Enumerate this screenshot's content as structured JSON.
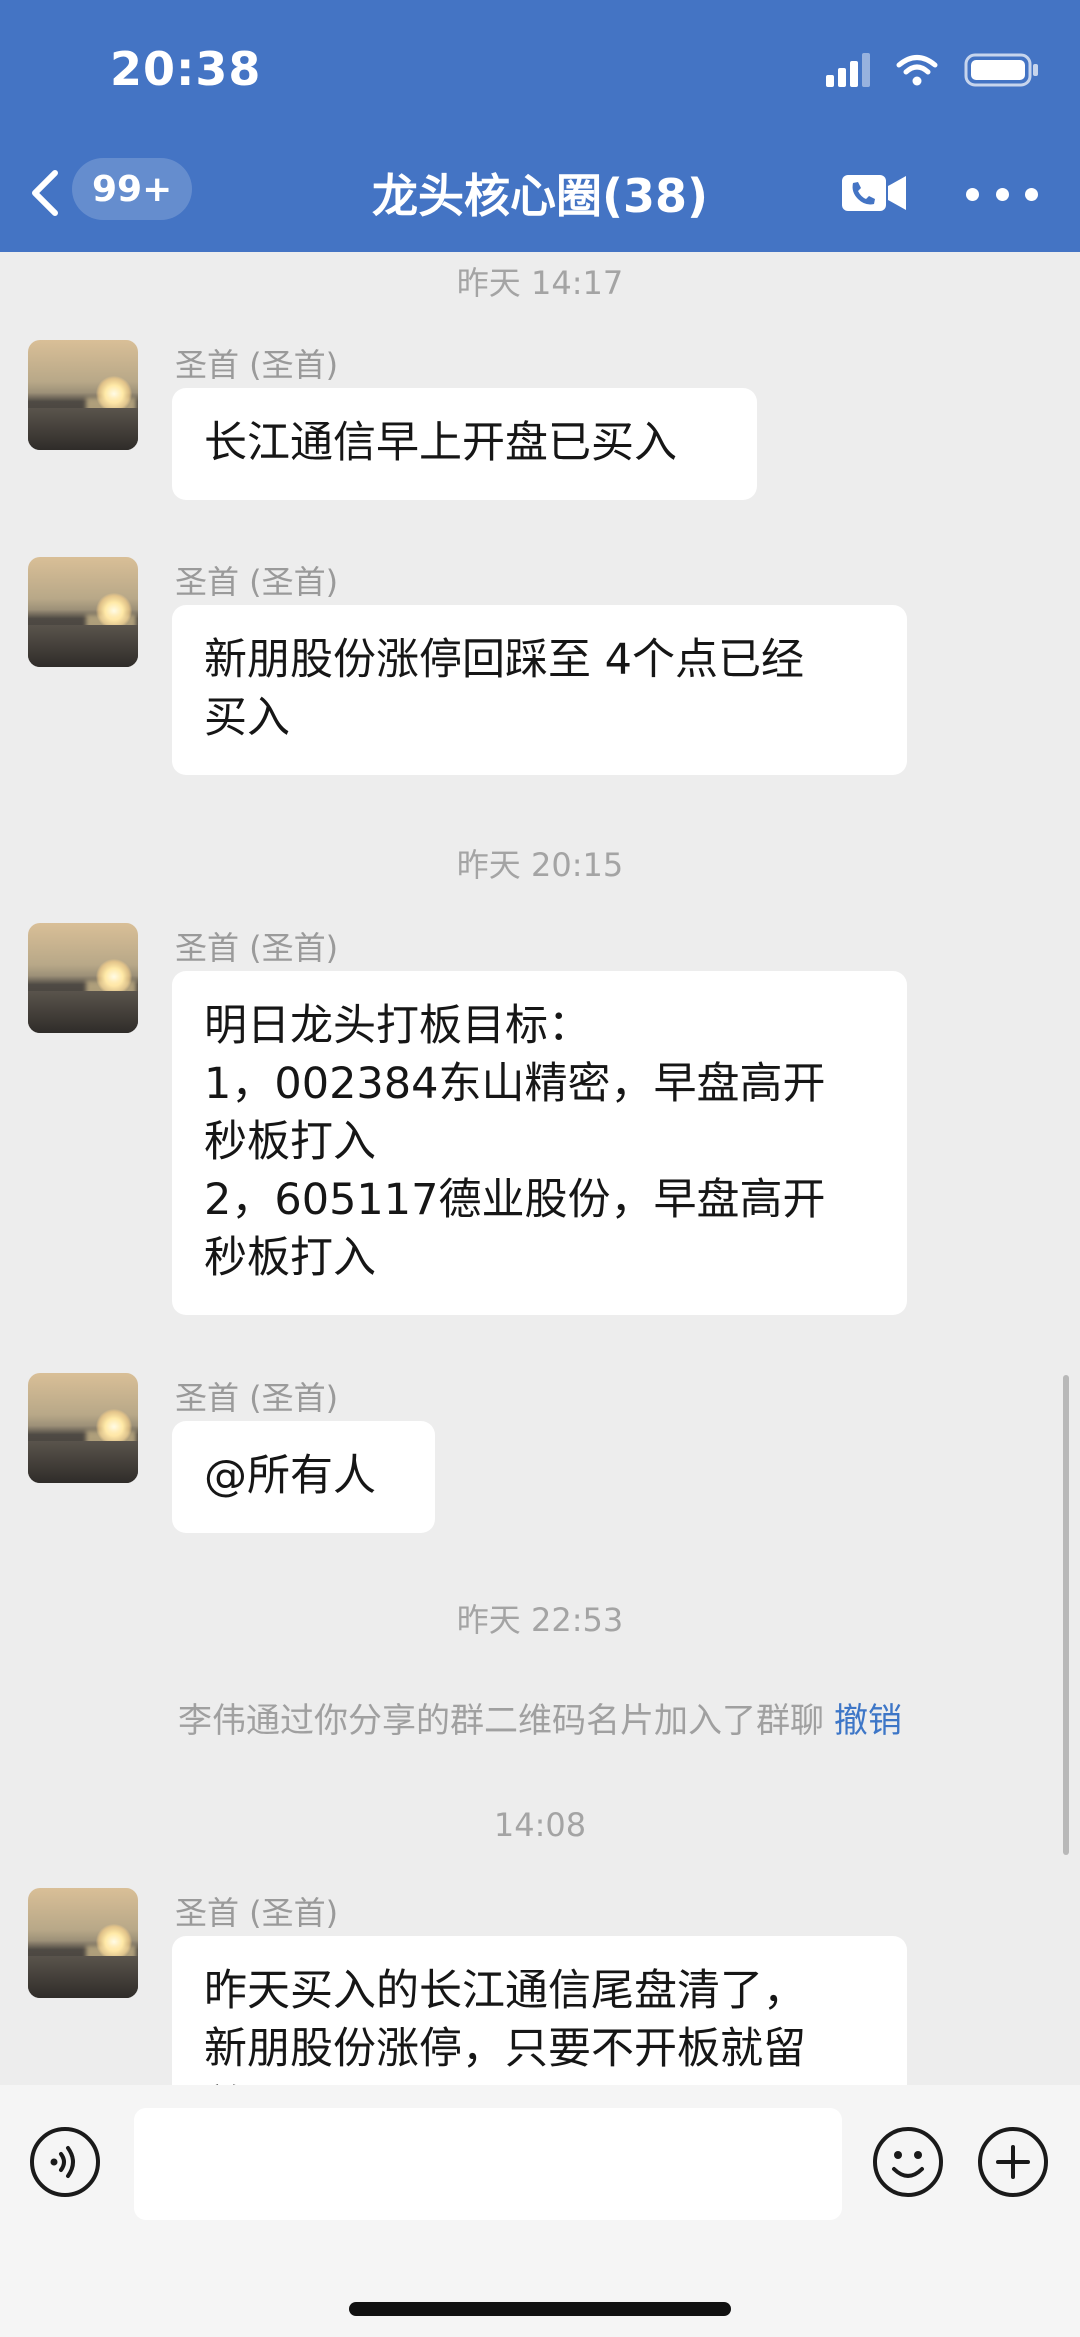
{
  "status_bar": {
    "time": "20:38"
  },
  "header": {
    "back_badge": "99+",
    "title": "龙头核心圈(38)"
  },
  "messages": [
    {
      "type": "time",
      "text": "昨天 14:17"
    },
    {
      "type": "msg",
      "sender": "圣首 (圣首)",
      "lines": [
        "长江通信早上开盘已买入"
      ]
    },
    {
      "type": "msg",
      "sender": "圣首 (圣首)",
      "lines": [
        "新朋股份涨停回踩至 4个点已经",
        "买入"
      ]
    },
    {
      "type": "time",
      "text": "昨天 20:15"
    },
    {
      "type": "msg",
      "sender": "圣首 (圣首)",
      "lines": [
        "明日龙头打板目标：",
        "1，002384东山精密，早盘高开",
        "秒板打入",
        "2，605117德业股份，早盘高开",
        "秒板打入"
      ]
    },
    {
      "type": "msg",
      "sender": "圣首 (圣首)",
      "lines": [
        "@所有人"
      ]
    },
    {
      "type": "time",
      "text": "昨天 22:53"
    },
    {
      "type": "system",
      "text": "李伟通过你分享的群二维码名片加入了群聊",
      "link": "撤销"
    },
    {
      "type": "time",
      "text": "14:08"
    },
    {
      "type": "msg",
      "sender": "圣首 (圣首)",
      "lines": [
        "昨天买入的长江通信尾盘清了，",
        "新朋股份涨停，只要不开板就留",
        "着"
      ]
    }
  ],
  "input": {
    "placeholder": ""
  },
  "icons": [
    "chevron-left-icon",
    "video-call-icon",
    "more-icon",
    "voice-icon",
    "emoji-icon",
    "plus-icon"
  ],
  "colors": {
    "header": "#4474c4",
    "background": "#ededed",
    "link": "#3d76c7"
  }
}
